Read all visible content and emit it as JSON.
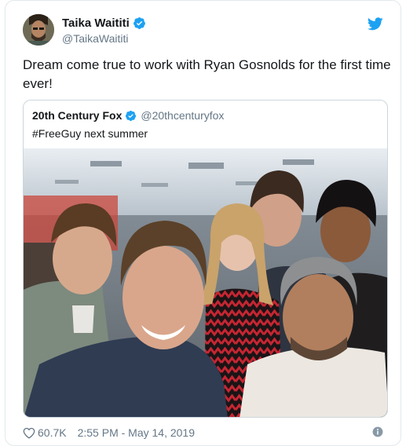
{
  "tweet": {
    "author": {
      "display_name": "Taika Waititi",
      "handle": "@TaikaWaititi",
      "verified": true
    },
    "text": "Dream come true to work with Ryan Gosnolds for the first time ever!",
    "quoted": {
      "display_name": "20th Century Fox",
      "handle": "@20thcenturyfox",
      "verified": true,
      "text": "#FreeGuy next summer"
    },
    "footer": {
      "likes": "60.7K",
      "timestamp": "2:55 PM - May 14, 2019"
    }
  },
  "colors": {
    "twitter_blue": "#1da1f2",
    "secondary_text": "#657786",
    "border": "#e1e8ed"
  },
  "icons": {
    "verified": "verified-badge-icon",
    "bird": "twitter-bird-icon",
    "like": "heart-icon",
    "info": "info-icon"
  }
}
